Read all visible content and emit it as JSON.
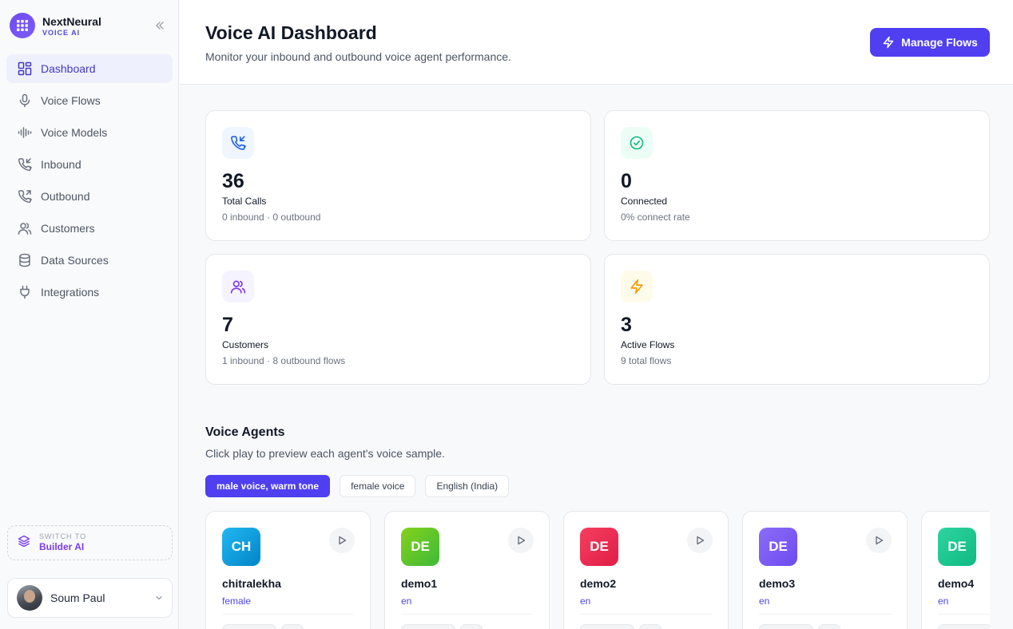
{
  "brand": {
    "name": "NextNeural",
    "sub": "VOICE AI"
  },
  "sidebar": {
    "items": [
      {
        "label": "Dashboard",
        "icon": "dashboard-icon",
        "active": true
      },
      {
        "label": "Voice Flows",
        "icon": "microphone-icon"
      },
      {
        "label": "Voice Models",
        "icon": "waveform-icon"
      },
      {
        "label": "Inbound",
        "icon": "phone-incoming-icon"
      },
      {
        "label": "Outbound",
        "icon": "phone-outgoing-icon"
      },
      {
        "label": "Customers",
        "icon": "users-icon"
      },
      {
        "label": "Data Sources",
        "icon": "database-icon"
      },
      {
        "label": "Integrations",
        "icon": "plug-icon"
      }
    ],
    "switch": {
      "label": "SWITCH TO",
      "name": "Builder AI"
    },
    "user": {
      "name": "Soum Paul"
    }
  },
  "header": {
    "title": "Voice AI Dashboard",
    "subtitle": "Monitor your inbound and outbound voice agent performance.",
    "manage_label": "Manage Flows"
  },
  "stats": [
    {
      "value": "36",
      "label": "Total Calls",
      "sub": "0 inbound · 0 outbound",
      "icon": "phone-incoming-icon",
      "color": "#2563eb"
    },
    {
      "value": "0",
      "label": "Connected",
      "sub": "0% connect rate",
      "icon": "check-circle-icon",
      "color": "#10b981"
    },
    {
      "value": "7",
      "label": "Customers",
      "sub": "1 inbound · 8 outbound flows",
      "icon": "users-icon",
      "color": "#7c3aed"
    },
    {
      "value": "3",
      "label": "Active Flows",
      "sub": "9 total flows",
      "icon": "lightning-icon",
      "color": "#f59e0b"
    }
  ],
  "agents_section": {
    "title": "Voice Agents",
    "subtitle": "Click play to preview each agent's voice sample.",
    "chips": [
      {
        "label": "male voice, warm tone",
        "active": true
      },
      {
        "label": "female voice"
      },
      {
        "label": "English (India)"
      }
    ],
    "agents": [
      {
        "initials": "CH",
        "name": "chitralekha",
        "tag": "female",
        "color": "#0ea5e9"
      },
      {
        "initials": "DE",
        "name": "demo1",
        "tag": "en",
        "color": "#65c92a"
      },
      {
        "initials": "DE",
        "name": "demo2",
        "tag": "en",
        "color": "#ef3355"
      },
      {
        "initials": "DE",
        "name": "demo3",
        "tag": "en",
        "color": "#7c5cf6"
      },
      {
        "initials": "DE",
        "name": "demo4",
        "tag": "en",
        "color": "#1fc99a"
      }
    ]
  }
}
